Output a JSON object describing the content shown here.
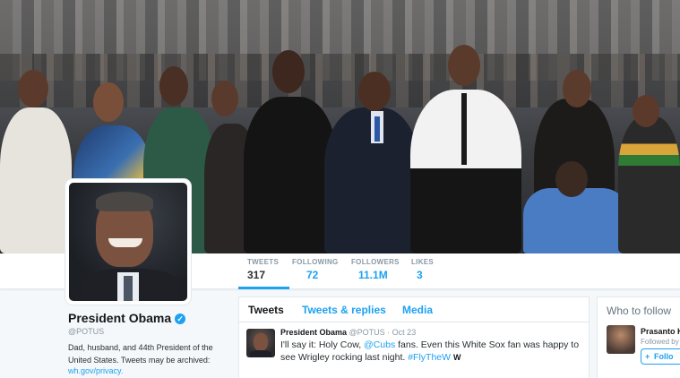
{
  "stats": [
    {
      "label": "TWEETS",
      "value": "317"
    },
    {
      "label": "FOLLOWING",
      "value": "72"
    },
    {
      "label": "FOLLOWERS",
      "value": "11.1M"
    },
    {
      "label": "LIKES",
      "value": "3"
    }
  ],
  "profile": {
    "name": "President Obama",
    "handle": "@POTUS",
    "bio": "Dad, husband, and 44th President of the United States. Tweets may be archived:",
    "link": "wh.gov/privacy."
  },
  "tabs": [
    "Tweets",
    "Tweets & replies",
    "Media"
  ],
  "tweet": {
    "name": "President Obama",
    "meta": "@POTUS · Oct 23",
    "text_pre": "I'll say it: Holy Cow, ",
    "mention": "@Cubs",
    "text_mid": " fans. Even this White Sox fan was happy to see Wrigley rocking last night. ",
    "hashtag": "#FlyTheW",
    "emoji": "W"
  },
  "who_to_follow": {
    "title": "Who to follow",
    "name": "Prasanto K",
    "sub": "Followed by",
    "follow_label": "Follo"
  },
  "colors": {
    "accent": "#1da1f2",
    "verified": "#1da1f2"
  },
  "icons": {
    "verified": "verified-badge-icon",
    "follow": "follow-plus-icon"
  }
}
